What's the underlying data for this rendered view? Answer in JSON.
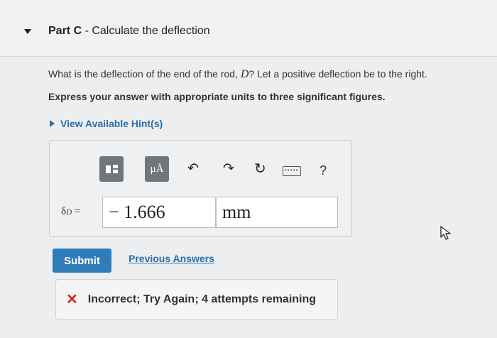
{
  "part": {
    "label": "Part C",
    "separator": " - ",
    "title": "Calculate the deflection"
  },
  "question": {
    "text_before": "What is the deflection of the end of the rod, ",
    "variable": "D",
    "text_after": "? Let a positive deflection be to the right."
  },
  "instruction": "Express your answer with appropriate units to three significant figures.",
  "hints": {
    "label": "View Available Hint(s)"
  },
  "toolbar": {
    "units_label": "μÅ",
    "undo_icon": "↶",
    "redo_icon": "↷",
    "reset_icon": "↻",
    "help_label": "?"
  },
  "answer": {
    "symbol": "δ",
    "subscript": "D",
    "equals": " =",
    "value": "− 1.666",
    "units": "mm"
  },
  "actions": {
    "submit_label": "Submit",
    "previous_answers_label": "Previous Answers"
  },
  "feedback": {
    "icon": "✕",
    "message": "Incorrect; Try Again; 4 attempts remaining"
  },
  "colors": {
    "link": "#2a6ea8",
    "submit": "#2f7db8",
    "error": "#d0281d"
  }
}
